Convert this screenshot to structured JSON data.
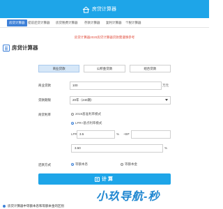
{
  "header": {
    "logo_text": "房贷计算器",
    "bg_color": "#1ea5e8"
  },
  "nav": {
    "items": [
      {
        "label": "房贷计算器",
        "active": true
      },
      {
        "label": "提前还贷计算器",
        "active": false
      },
      {
        "label": "房贷税费计算器",
        "active": false
      },
      {
        "label": "存款计算器",
        "active": false
      },
      {
        "label": "复利计算器",
        "active": false
      },
      {
        "label": "个税计算器",
        "active": false
      }
    ]
  },
  "notice": "房贷计算器2020房贷计算器贷款需谨慎参考",
  "card": {
    "title": "房贷计算器"
  },
  "tabs": [
    {
      "label": "商业贷款",
      "active": true
    },
    {
      "label": "公积金贷款",
      "active": false
    },
    {
      "label": "组合贷款",
      "active": false
    }
  ],
  "form": {
    "loan_amount": {
      "label": "商业贷款",
      "value": "100",
      "unit": "万元"
    },
    "loan_term": {
      "label": "贷款期限",
      "value": "20年（240期）"
    },
    "rate": {
      "label": "商贷利率",
      "option_2019": "2019基准利率模式",
      "option_lpr": "LPR+基点利率模式",
      "lpr_label": "LPR",
      "lpr_value": "3.5",
      "lpr_unit": "%",
      "bp_label": "+BP",
      "result_value": "3.50",
      "result_unit": "%"
    },
    "repay": {
      "label": "还款方式",
      "option_equal_payment": "等额本息",
      "option_equal_principal": "等额本金"
    }
  },
  "calc_button": {
    "label": "计算"
  },
  "watermark": "小玖导航-秒",
  "footer": {
    "text": "房贷计算器中等额本息和等额本金的区别"
  }
}
